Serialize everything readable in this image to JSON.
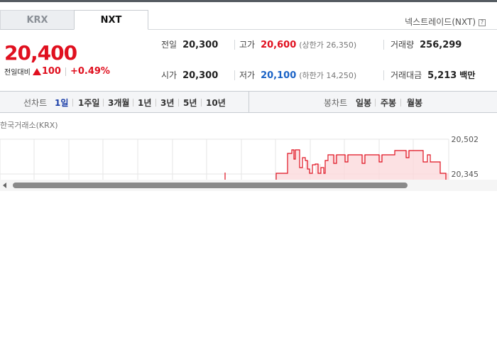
{
  "tabs": [
    {
      "label": "KRX",
      "active": false
    },
    {
      "label": "NXT",
      "active": true
    }
  ],
  "nxt_link": {
    "label": "넥스트레이드(NXT)",
    "help": "?"
  },
  "price": {
    "current": "20,400",
    "change_label": "전일대비",
    "change_value": "100",
    "change_pct": "+0.49%",
    "direction": "up"
  },
  "stats": {
    "prev_close": {
      "label": "전일",
      "value": "20,300"
    },
    "high": {
      "label": "고가",
      "value": "20,600",
      "sub": "(상한가 26,350)"
    },
    "volume": {
      "label": "거래량",
      "value": "256,299"
    },
    "open": {
      "label": "시가",
      "value": "20,300"
    },
    "low": {
      "label": "저가",
      "value": "20,100",
      "sub": "(하한가 14,250)"
    },
    "amount": {
      "label": "거래대금",
      "value": "5,213",
      "unit": "백만"
    }
  },
  "chart_bar": {
    "line_label": "선차트",
    "line_periods": [
      "1일",
      "1주일",
      "3개월",
      "1년",
      "3년",
      "5년",
      "10년"
    ],
    "active_period": "1일",
    "candle_label": "봉차트",
    "candle_periods": [
      "일봉",
      "주봉",
      "월봉"
    ]
  },
  "chart_source": "한국거래소(KRX)",
  "chart_data": {
    "type": "line",
    "y_ticks": [
      "20,502",
      "20,345"
    ],
    "grid": true
  },
  "colors": {
    "up": "#e0101f",
    "down": "#1b63c6",
    "active_period": "#1b3fa8"
  }
}
